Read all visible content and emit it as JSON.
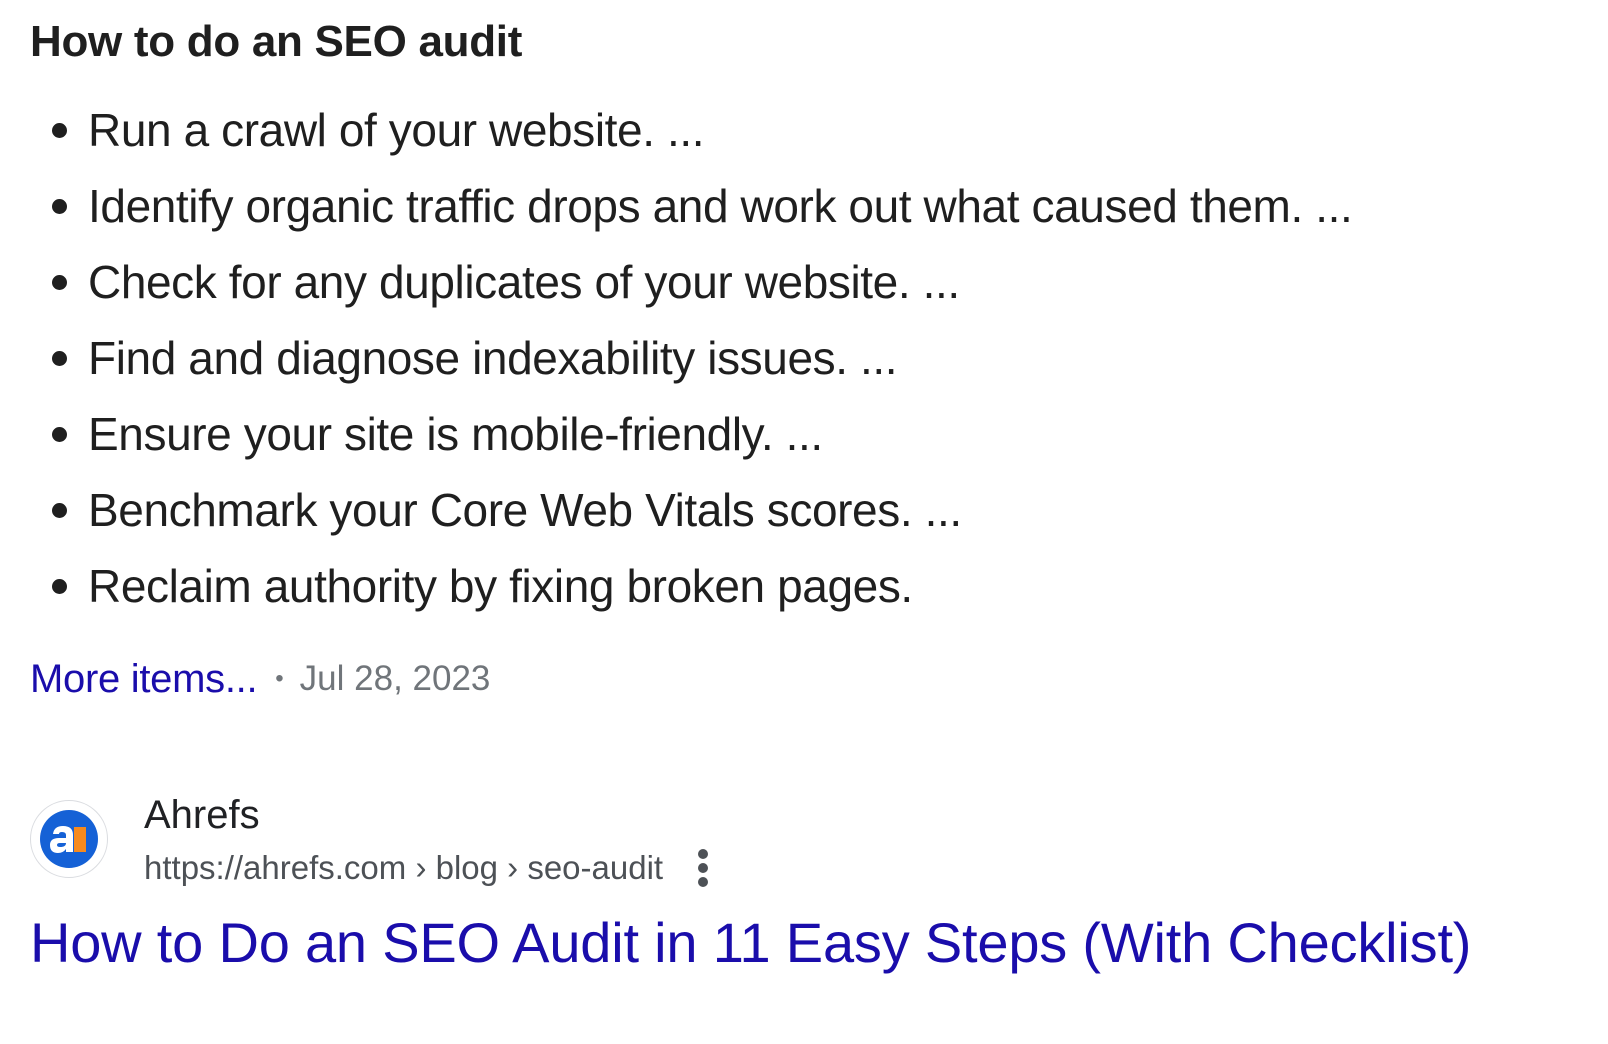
{
  "snippet": {
    "heading": "How to do an SEO audit",
    "steps": [
      "Run a crawl of your website. ...",
      "Identify organic traffic drops and work out what caused them. ...",
      "Check for any duplicates of your website. ...",
      "Find and diagnose indexability issues. ...",
      "Ensure your site is mobile-friendly. ...",
      "Benchmark your Core Web Vitals scores. ...",
      "Reclaim authority by fixing broken pages."
    ],
    "more_items_label": "More items...",
    "separator": "•",
    "date": "Jul 28, 2023"
  },
  "result": {
    "favicon_icon": "ahrefs-logo-icon",
    "site_name": "Ahrefs",
    "breadcrumb": "https://ahrefs.com › blog › seo-audit",
    "more_options_icon": "three-dots-vertical-icon",
    "title": "How to Do an SEO Audit in 11 Easy Steps (With Checklist)"
  },
  "colors": {
    "link": "#1a0dab",
    "text": "#1f1f1f",
    "secondary_text": "#70757a",
    "url_text": "#4d5156",
    "favicon_blue": "#1561d6",
    "favicon_orange": "#f68a1e"
  }
}
